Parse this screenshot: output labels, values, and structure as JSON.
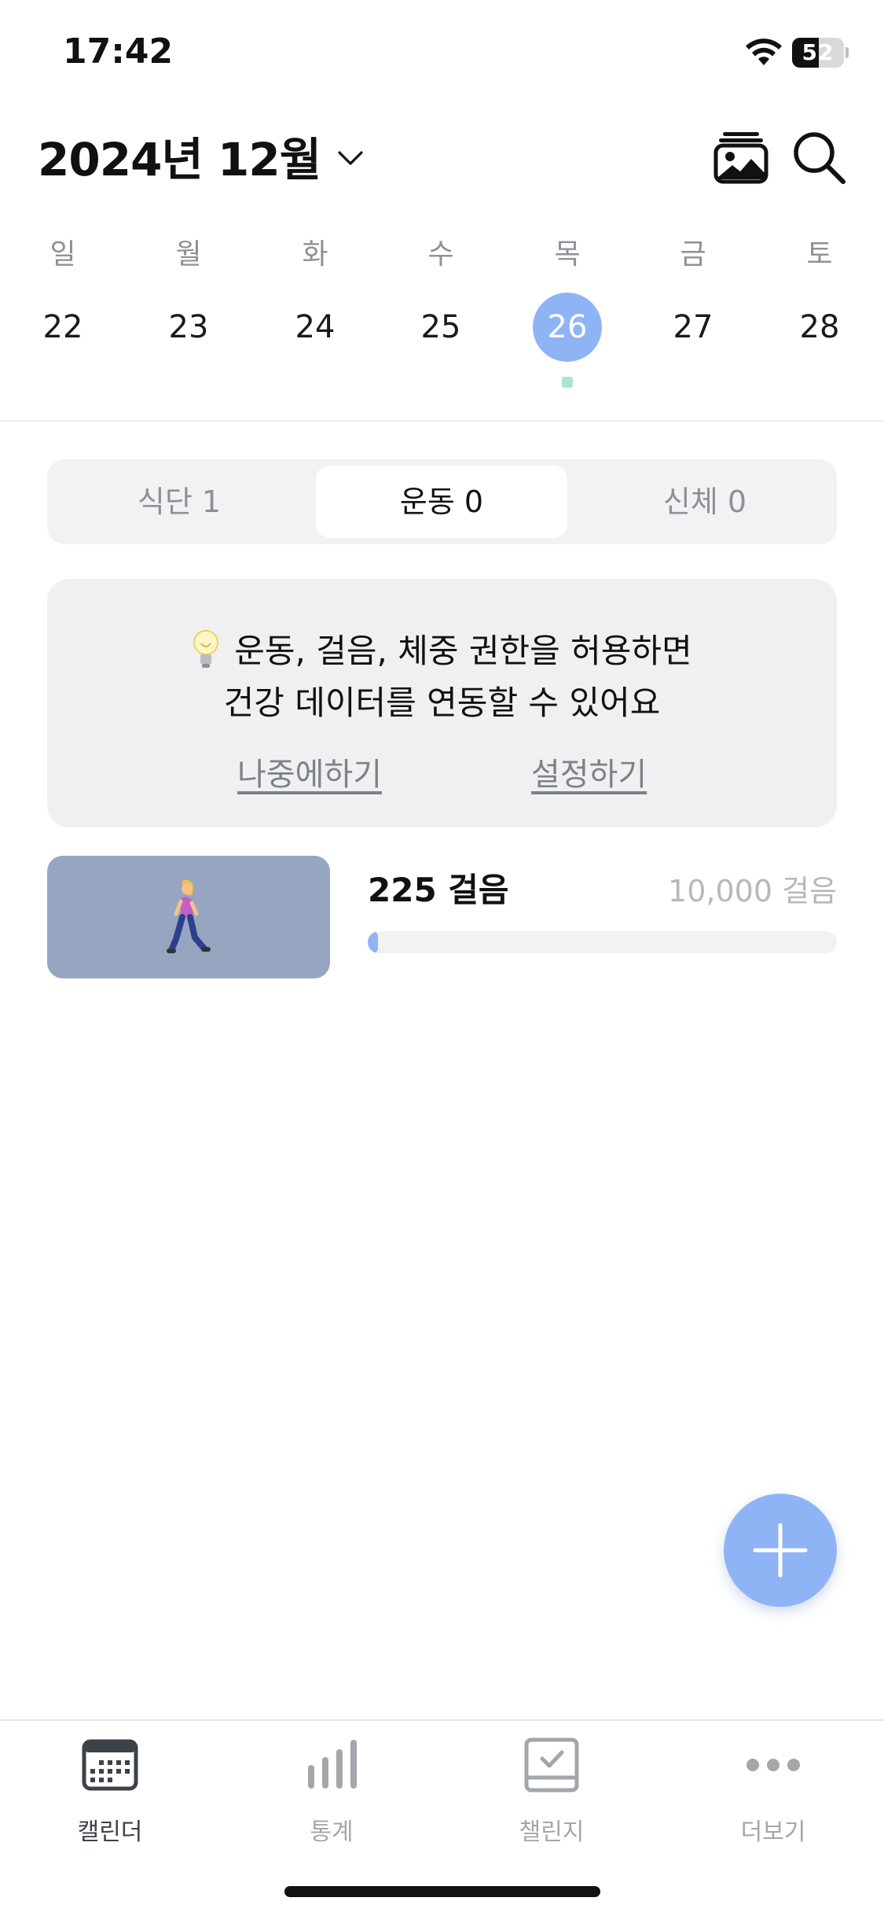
{
  "status_bar": {
    "time": "17:42",
    "battery_level": "52",
    "battery_fraction": 0.52,
    "icons": [
      "wifi-icon",
      "battery-icon"
    ]
  },
  "header": {
    "month_title": "2024년 12월",
    "icons": [
      "chevron-down-icon",
      "gallery-icon",
      "search-icon"
    ]
  },
  "week": {
    "days": [
      {
        "label": "일",
        "number": "22"
      },
      {
        "label": "월",
        "number": "23"
      },
      {
        "label": "화",
        "number": "24"
      },
      {
        "label": "수",
        "number": "25"
      },
      {
        "label": "목",
        "number": "26"
      },
      {
        "label": "금",
        "number": "27"
      },
      {
        "label": "토",
        "number": "28"
      }
    ],
    "selected_day": "26",
    "selected_color": "#8fb4f5",
    "event_dot_color": "#a8e6d2"
  },
  "segments": {
    "tabs": [
      {
        "label": "식단 1"
      },
      {
        "label": "운동 0"
      },
      {
        "label": "신체 0"
      }
    ],
    "active": "운동 0"
  },
  "permission_card": {
    "line1": "운동, 걸음, 체중 권한을 허용하면",
    "line2": "건강 데이터를 연동할 수 있어요",
    "later_label": "나중에하기",
    "settings_label": "설정하기",
    "icon": "lightbulb-icon"
  },
  "steps": {
    "count_label": "225 걸음",
    "goal_label": "10,000 걸음",
    "progress": 0.0225,
    "icon": "walking-person-icon"
  },
  "fab": {
    "icon": "plus-icon",
    "color": "#8fb4f5"
  },
  "tab_bar": {
    "items": [
      {
        "label": "캘린더",
        "icon": "calendar-icon"
      },
      {
        "label": "통계",
        "icon": "bar-chart-icon"
      },
      {
        "label": "챌린지",
        "icon": "checkbox-icon"
      },
      {
        "label": "더보기",
        "icon": "more-icon"
      }
    ],
    "active": "캘린더"
  }
}
